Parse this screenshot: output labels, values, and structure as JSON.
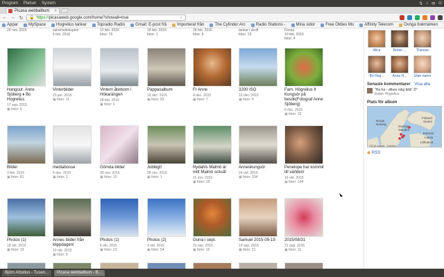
{
  "system": {
    "menus": [
      "Program",
      "Platser",
      "System"
    ],
    "clock": ""
  },
  "browser": {
    "tab_title": "Picasa webbalbum",
    "url_scheme": "https://",
    "url_rest": "picasaweb.google.com/home?showall=true",
    "bookmarks": [
      "Appar",
      "MySpace",
      "Hogrelius tankar",
      "Topradio Radio",
      "Gmail: E-post frå",
      "Importerat från",
      "The Cylinder Arc",
      "Radio Stations -",
      "Mina sidor",
      "Free Oldies Mu",
      "Affinity Telecom",
      "Övriga bokmärken"
    ]
  },
  "top_row": [
    {
      "caption": "29 nov. 2015"
    },
    {
      "caption": "sakerheltskopieri\n5 feb. 2016"
    },
    {
      "caption": "12 feb. 2016\nfotor: 76"
    },
    {
      "caption": "18 feb. 2016\nfotor: 1"
    },
    {
      "caption": "18 feb. 2016\nfotor: 6"
    },
    {
      "caption": "tankar i skrift\nfotor: 23"
    },
    {
      "caption": "Första\n10 feb. 2016\nfotor: 4"
    }
  ],
  "albums_row1": [
    {
      "title": "Hangout: Anne Sjöberg ♦ Bo Hogrelius",
      "date": "17 sep. 2015",
      "photos": "fotor: 6"
    },
    {
      "title": "Vinterbilder",
      "date": "23 jan. 2015",
      "photos": "fotor: 11"
    },
    {
      "title": "Vintern återkom i Hökarängen",
      "date": "28 feb. 2016",
      "photos": "fotor: 6"
    },
    {
      "title": "Pappasalbum",
      "date": "19 dec. 2015",
      "photos": "fotor: 93"
    },
    {
      "title": "Fr Anne",
      "date": "4 dec. 2015",
      "photos": "fotor: 7"
    },
    {
      "title": "3200 ISO",
      "date": "10 dec. 2015",
      "photos": "fotor: 6"
    },
    {
      "title": "Fam. Högrelius fr Kungsör på besök(Fotograf Anne Sjöberg)",
      "date": "6 dec. 2015",
      "photos": "fotor: 32"
    }
  ],
  "albums_row2": [
    {
      "title": "Bilder",
      "date": "3 feb. 2015",
      "photos": "fotor: 81"
    },
    {
      "title": "mediabosse",
      "date": "5 dec. 2015",
      "photos": "fotor: 2"
    },
    {
      "title": "Gömda bilder",
      "date": "30 nov. 2015",
      "photos": "fotor: 10"
    },
    {
      "title": "Jobbigt!",
      "date": "18 nov. 2015",
      "photos": "fotor: 1"
    },
    {
      "title": "Nydahls Malmö är mitt Malmö också!",
      "date": "11 nov. 2015",
      "photos": "fotor: 16"
    },
    {
      "title": "Anneskungsör",
      "date": "24 okt. 2015",
      "photos": "fotor: 334"
    },
    {
      "title": "Penelope har kommit till världen!",
      "date": "19 okt. 2015",
      "photos": "fotor: 144"
    }
  ],
  "albums_row3": [
    {
      "title": "Photos (1)",
      "date": "18 okt. 2015",
      "photos": "fotor: 19"
    },
    {
      "title": "Annes bilder från klippdagen!",
      "date": "10 okt. 2015",
      "photos": "fotor: 5"
    },
    {
      "title": "Photos (1)",
      "date": "6 okt. 2015",
      "photos": "fotor: 13"
    },
    {
      "title": "Photos (2)",
      "date": "3 okt. 2015",
      "photos": "fotor: 54"
    },
    {
      "title": "Gurra i sept.",
      "date": "20 sep. 2015",
      "photos": "fotor: 15"
    },
    {
      "title": "Samuel 2015-09-19",
      "date": "19 sep. 2015",
      "photos": "fotor: 31"
    },
    {
      "title": "2015/08/31",
      "date": "31 aug. 2015",
      "photos": "fotor: 11"
    }
  ],
  "sidebar": {
    "people": [
      "Alice",
      "Robin ...",
      "Therese",
      "Bo Hog...",
      "Anna H...",
      "Utan namn"
    ],
    "comments_heading": "Senaste kommentarer",
    "comments_link": "Visa alla",
    "comment_text": "\"Ha ha - vilken rolig bild! :D\"",
    "comment_by": "Robin Högrelius",
    "map_heading": "Plats för album",
    "map_labels": [
      "Norge",
      "Norway",
      "Sverige",
      "Sweden",
      "Finland",
      "Suomi",
      "Estonia",
      "Latvia",
      "Lithuania"
    ],
    "map_footer": "©2016 Google - Kartdata",
    "rss": "RSS"
  },
  "taskbar": {
    "items": [
      "Björn Afzelius - Tusen...",
      "Picasa webbalbum - B..."
    ]
  },
  "colors": {
    "sysbar": "#3c3b37",
    "link": "#2a5db0",
    "secure": "#0a8a0a"
  }
}
